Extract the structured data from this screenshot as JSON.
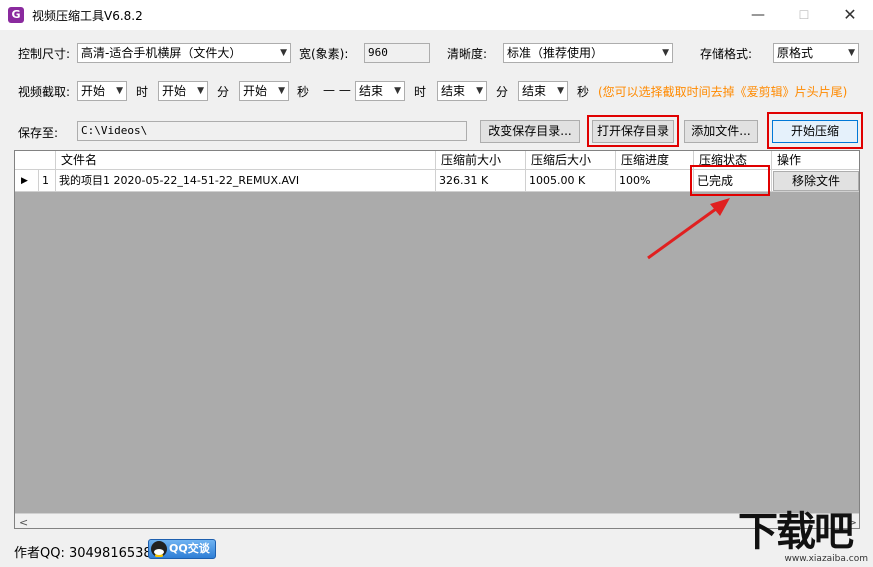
{
  "window": {
    "title": "视频压缩工具V6.8.2",
    "app_icon_glyph": "G",
    "controls": {
      "minimize": "—",
      "maximize": "☐",
      "close": "✕"
    }
  },
  "row1": {
    "size_label": "控制尺寸:",
    "size_value": "高清-适合手机横屏（文件大）",
    "width_label": "宽(象素):",
    "width_value": "960",
    "clarity_label": "清晰度:",
    "clarity_value": "标准（推荐使用）",
    "format_label": "存储格式:",
    "format_value": "原格式"
  },
  "row2": {
    "clip_label": "视频截取:",
    "start_hour": "开始",
    "hour_unit": "时",
    "start_min": "开始",
    "min_unit": "分",
    "start_sec": "开始",
    "sec_unit": "秒",
    "dash": "— —",
    "end_hour": "结束",
    "end_hour_unit": "时",
    "end_min": "结束",
    "end_min_unit": "分",
    "end_sec": "结束",
    "end_sec_unit": "秒",
    "hint": "(您可以选择截取时间去掉《爱剪辑》片头片尾)"
  },
  "row3": {
    "save_label": "保存至:",
    "save_path": "C:\\Videos\\",
    "change_dir_btn": "改变保存目录...",
    "open_dir_btn": "打开保存目录",
    "add_file_btn": "添加文件...",
    "start_btn": "开始压缩"
  },
  "table": {
    "headers": [
      "文件名",
      "压缩前大小",
      "压缩后大小",
      "压缩进度",
      "压缩状态",
      "操作"
    ],
    "rows": [
      {
        "indicator": "▶",
        "index": "1",
        "filename": "我的项目1 2020-05-22_14-51-22_REMUX.AVI",
        "before_size": "326.31 K",
        "after_size": "1005.00 K",
        "progress": "100%",
        "status": "已完成",
        "action": "移除文件"
      }
    ],
    "scroll_left": "<",
    "scroll_right": ">"
  },
  "footer": {
    "author_qq": "作者QQ: 3049816538",
    "qq_badge": "QQ交谈"
  },
  "watermark": {
    "text": "下载吧",
    "url": "www.xiazaiba.com"
  },
  "colors": {
    "highlight": "#e00000",
    "arrow": "#e02020",
    "hint": "#ff8a00"
  }
}
